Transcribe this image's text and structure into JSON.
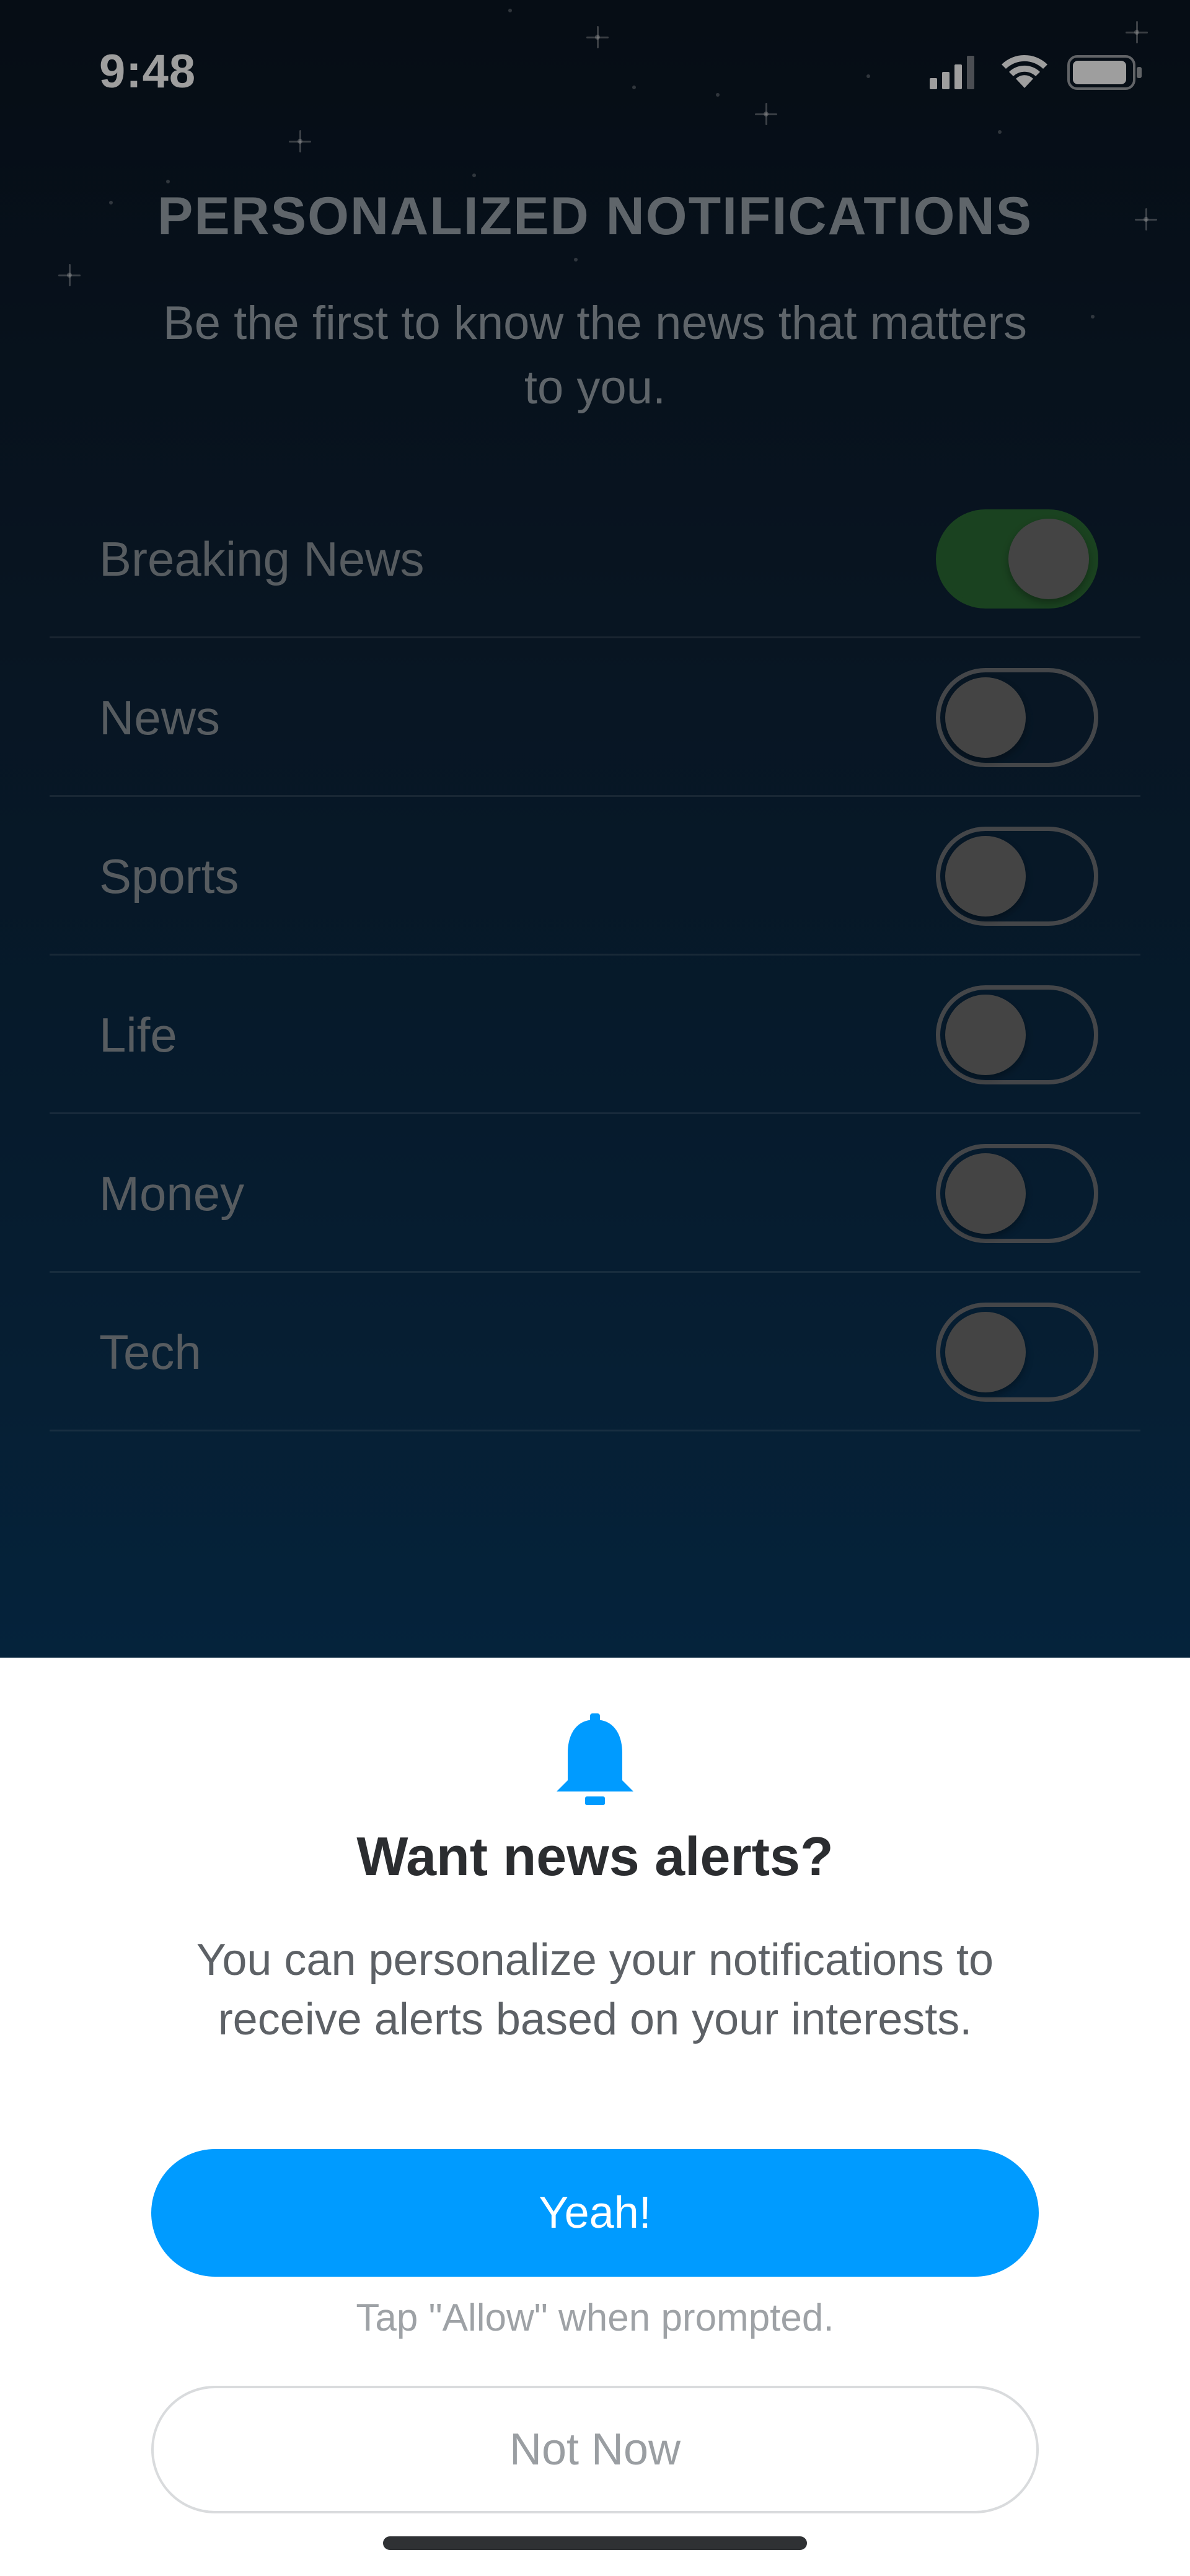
{
  "status_bar": {
    "time": "9:48",
    "icons": [
      "signal-icon",
      "wifi-icon",
      "battery-icon"
    ]
  },
  "header": {
    "title": "PERSONALIZED NOTIFICATIONS",
    "subtitle": "Be the first to know the news that matters to you."
  },
  "topics": [
    {
      "label": "Breaking News",
      "enabled": true
    },
    {
      "label": "News",
      "enabled": false
    },
    {
      "label": "Sports",
      "enabled": false
    },
    {
      "label": "Life",
      "enabled": false
    },
    {
      "label": "Money",
      "enabled": false
    },
    {
      "label": "Tech",
      "enabled": false
    }
  ],
  "sheet": {
    "icon": "bell-icon",
    "title": "Want news alerts?",
    "body": "You can personalize your notifications to receive alerts based on your interests.",
    "primary_label": "Yeah!",
    "hint": "Tap \"Allow\" when prompted.",
    "secondary_label": "Not Now"
  },
  "colors": {
    "accent": "#009bff",
    "toggle_on": "#2b6b34",
    "background_top": "#0b1522",
    "background_bottom": "#073f6a"
  }
}
